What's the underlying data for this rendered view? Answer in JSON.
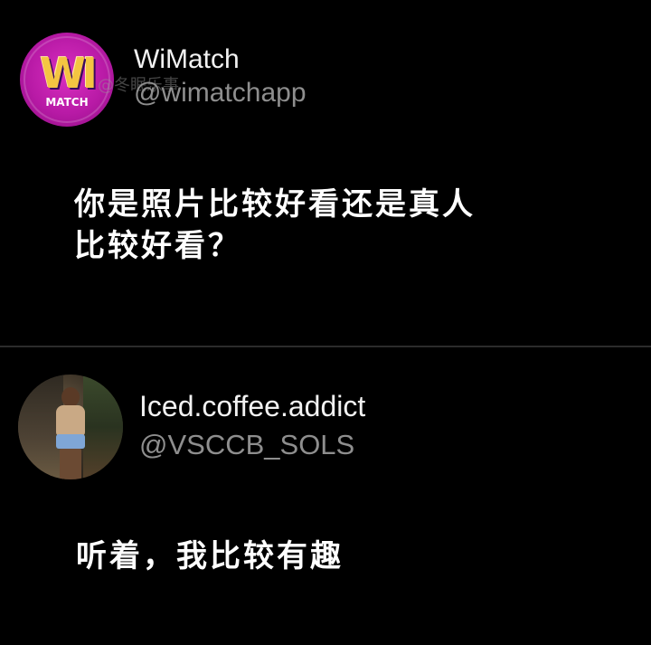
{
  "posts": [
    {
      "avatar": {
        "logo_text": "WI",
        "logo_sub": "MATCH"
      },
      "display_name": "WiMatch",
      "handle": "@wimatchapp",
      "watermark": "@冬眠乐事",
      "text_lines": [
        "你是照片比较好看还是真人",
        "比较好看？"
      ]
    },
    {
      "avatar": {
        "description_icon": "profile-photo"
      },
      "display_name": "Iced.coffee.addict",
      "handle": "@VSCCB_SOLS",
      "text_lines": [
        "听着，我比较有趣"
      ]
    }
  ],
  "colors": {
    "background": "#000000",
    "divider": "#2b2b2b",
    "name": "#f2f2f2",
    "handle": "#8e8e8e",
    "brand_magenta": "#c21fb0",
    "brand_gold": "#f4c542"
  }
}
